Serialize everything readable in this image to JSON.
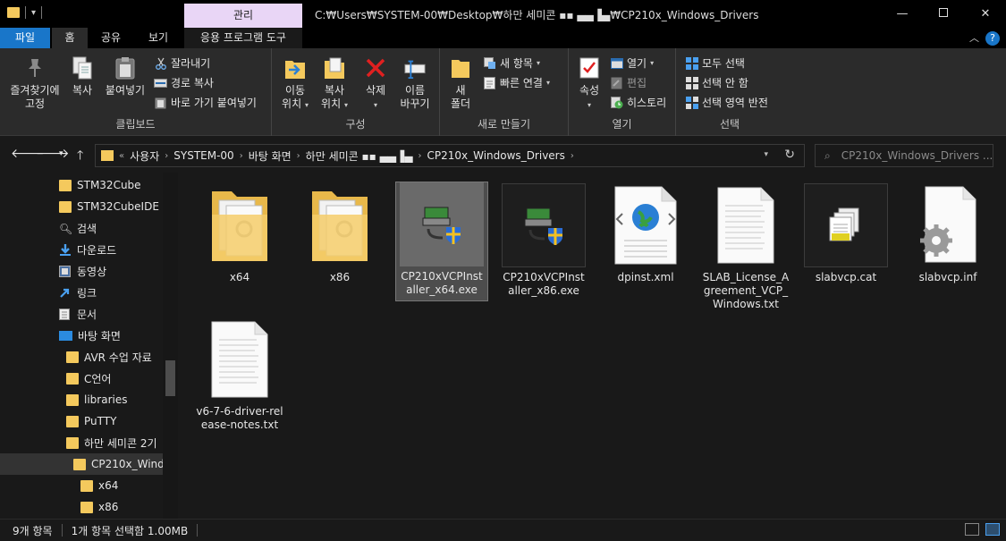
{
  "window": {
    "manage_tab": "관리",
    "path": "C:₩Users₩SYSTEM-00₩Desktop₩하만 세미콘 ▪▪ ▄▄▐▄₩CP210x_Windows_Drivers",
    "minimize": "—",
    "close": "✕"
  },
  "tabs": {
    "file": "파일",
    "home": "홈",
    "share": "공유",
    "view": "보기",
    "apptools": "응용 프로그램 도구"
  },
  "ribbon": {
    "clipboard": {
      "label": "클립보드",
      "pin_line1": "즐겨찾기에",
      "pin_line2": "고정",
      "copy": "복사",
      "paste": "붙여넣기",
      "cut": "잘라내기",
      "copy_path": "경로 복사",
      "paste_shortcut": "바로 가기 붙여넣기"
    },
    "organize": {
      "label": "구성",
      "move_line1": "이동",
      "move_line2": "위치",
      "copyto_line1": "복사",
      "copyto_line2": "위치",
      "delete": "삭제",
      "rename_line1": "이름",
      "rename_line2": "바꾸기"
    },
    "new": {
      "label": "새로 만들기",
      "new_folder_line1": "새",
      "new_folder_line2": "폴더",
      "new_item": "새 항목",
      "easy_access": "빠른 연결"
    },
    "open": {
      "label": "열기",
      "properties": "속성",
      "open": "열기",
      "edit": "편집",
      "history": "히스토리"
    },
    "select": {
      "label": "선택",
      "select_all": "모두 선택",
      "select_none": "선택 안 함",
      "invert": "선택 영역 반전"
    }
  },
  "address": {
    "overflow": "«",
    "crumbs": [
      "사용자",
      "SYSTEM-00",
      "바탕 화면",
      "하만 세미콘 ▪▪ ▄▄▐▄",
      "CP210x_Windows_Drivers"
    ],
    "search_placeholder": "CP210x_Windows_Drivers ..."
  },
  "navpane": [
    {
      "label": "STM32Cube",
      "icon": "folder-icon"
    },
    {
      "label": "STM32CubeIDE",
      "icon": "folder-icon"
    },
    {
      "label": "검색",
      "icon": "search-icon"
    },
    {
      "label": "다운로드",
      "icon": "download-icon"
    },
    {
      "label": "동영상",
      "icon": "video-icon"
    },
    {
      "label": "링크",
      "icon": "link-icon"
    },
    {
      "label": "문서",
      "icon": "document-icon"
    },
    {
      "label": "바탕 화면",
      "icon": "desktop-icon"
    },
    {
      "label": "AVR 수업 자료",
      "icon": "folder-icon"
    },
    {
      "label": "C언어",
      "icon": "folder-icon"
    },
    {
      "label": "libraries",
      "icon": "folder-icon"
    },
    {
      "label": "PuTTY",
      "icon": "folder-icon"
    },
    {
      "label": "하만 세미콘 2기",
      "icon": "folder-icon"
    },
    {
      "label": "CP210x_Windo",
      "icon": "folder-icon"
    },
    {
      "label": "x64",
      "icon": "folder-icon"
    },
    {
      "label": "x86",
      "icon": "folder-icon"
    }
  ],
  "files": [
    {
      "name": "x64",
      "icon": "folder-icon"
    },
    {
      "name": "x86",
      "icon": "folder-icon"
    },
    {
      "name": "CP210xVCPInstaller_x64.exe",
      "icon": "installer-icon"
    },
    {
      "name": "CP210xVCPInstaller_x86.exe",
      "icon": "installer-icon"
    },
    {
      "name": "dpinst.xml",
      "icon": "xml-icon"
    },
    {
      "name": "SLAB_License_Agreement_VCP_Windows.txt",
      "icon": "text-file-icon"
    },
    {
      "name": "slabvcp.cat",
      "icon": "catalog-icon"
    },
    {
      "name": "slabvcp.inf",
      "icon": "settings-file-icon"
    },
    {
      "name": "v6-7-6-driver-release-notes.txt",
      "icon": "text-file-icon"
    }
  ],
  "status": {
    "count": "9개 항목",
    "selection": "1개 항목 선택함 1.00MB"
  },
  "colors": {
    "accent": "#1976c9",
    "manage_tab": "#e9d6f6",
    "folder": "#f4c95d"
  }
}
